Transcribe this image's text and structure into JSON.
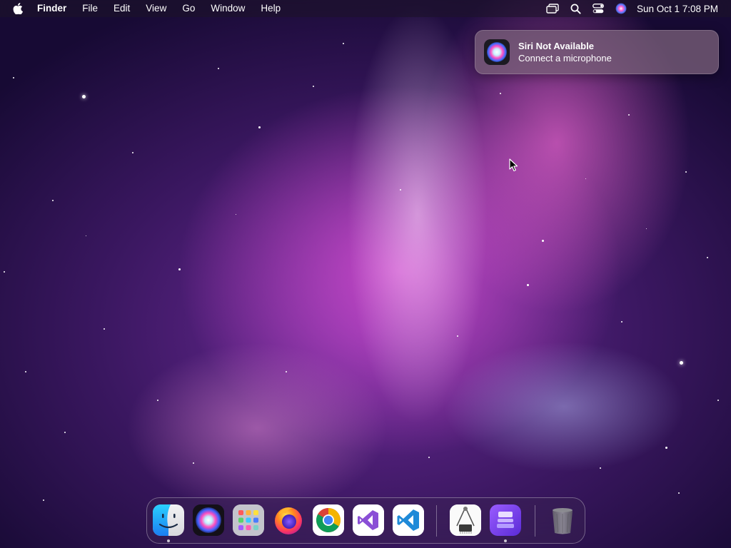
{
  "menubar": {
    "app_name": "Finder",
    "items": [
      "File",
      "Edit",
      "View",
      "Go",
      "Window",
      "Help"
    ],
    "clock": "Sun Oct 1  7:08 PM",
    "status_icons": [
      "screen-mirroring-icon",
      "spotlight-search-icon",
      "control-center-icon",
      "siri-icon"
    ]
  },
  "notification": {
    "title": "Siri Not Available",
    "body": "Connect a microphone",
    "icon": "siri-icon"
  },
  "dock": {
    "apps": [
      {
        "name": "Finder",
        "icon": "finder-icon",
        "running": true
      },
      {
        "name": "Siri",
        "icon": "siri-icon",
        "running": false
      },
      {
        "name": "Launchpad",
        "icon": "launchpad-icon",
        "running": false
      },
      {
        "name": "Firefox",
        "icon": "firefox-icon",
        "running": false
      },
      {
        "name": "Google Chrome",
        "icon": "chrome-icon",
        "running": false
      },
      {
        "name": "Visual Studio",
        "icon": "visual-studio-icon",
        "running": false
      },
      {
        "name": "Visual Studio Code",
        "icon": "vscode-icon",
        "running": false
      }
    ],
    "utilities": [
      {
        "name": "System Information",
        "icon": "system-information-icon",
        "running": false
      },
      {
        "name": "Apple Configurator",
        "icon": "apple-configurator-icon",
        "running": true
      }
    ],
    "trash": {
      "name": "Trash",
      "icon": "trash-icon"
    }
  },
  "colors": {
    "menubar_text": "#ffffff",
    "notification_bg": "#7a5f7a",
    "wallpaper_accent": "#c94fc9"
  }
}
